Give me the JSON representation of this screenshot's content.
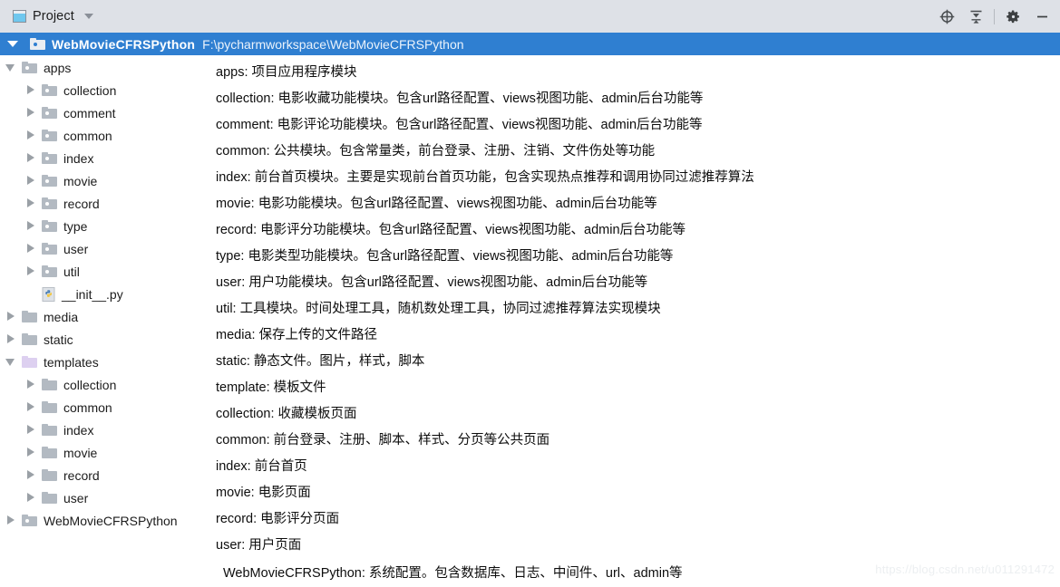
{
  "toolbar": {
    "tab_label": "Project",
    "project_icon": "project-panel-icon",
    "dropdown_icon": "chevron-down-icon",
    "actions": [
      {
        "name": "locate-target-icon",
        "glyph": "target"
      },
      {
        "name": "collapse-all-icon",
        "glyph": "collapse"
      },
      {
        "name": "settings-gear-icon",
        "glyph": "gear"
      },
      {
        "name": "hide-panel-icon",
        "glyph": "minus"
      }
    ]
  },
  "project_row": {
    "name": "WebMovieCFRSPython",
    "path": "F:\\pycharmworkspace\\WebMovieCFRSPython",
    "expanded": true
  },
  "tree": [
    {
      "label": "apps",
      "depth": 1,
      "state": "expanded",
      "icon": "folder-dot"
    },
    {
      "label": "collection",
      "depth": 2,
      "state": "collapsed",
      "icon": "folder-dot"
    },
    {
      "label": "comment",
      "depth": 2,
      "state": "collapsed",
      "icon": "folder-dot"
    },
    {
      "label": "common",
      "depth": 2,
      "state": "collapsed",
      "icon": "folder-dot"
    },
    {
      "label": "index",
      "depth": 2,
      "state": "collapsed",
      "icon": "folder-dot"
    },
    {
      "label": "movie",
      "depth": 2,
      "state": "collapsed",
      "icon": "folder-dot"
    },
    {
      "label": "record",
      "depth": 2,
      "state": "collapsed",
      "icon": "folder-dot"
    },
    {
      "label": "type",
      "depth": 2,
      "state": "collapsed",
      "icon": "folder-dot"
    },
    {
      "label": "user",
      "depth": 2,
      "state": "collapsed",
      "icon": "folder-dot"
    },
    {
      "label": "util",
      "depth": 2,
      "state": "collapsed",
      "icon": "folder-dot"
    },
    {
      "label": "__init__.py",
      "depth": 2,
      "state": "leaf",
      "icon": "python-file"
    },
    {
      "label": "media",
      "depth": 1,
      "state": "collapsed",
      "icon": "folder-plain"
    },
    {
      "label": "static",
      "depth": 1,
      "state": "collapsed",
      "icon": "folder-plain"
    },
    {
      "label": "templates",
      "depth": 1,
      "state": "expanded",
      "icon": "folder-purple"
    },
    {
      "label": "collection",
      "depth": 2,
      "state": "collapsed",
      "icon": "folder-plain"
    },
    {
      "label": "common",
      "depth": 2,
      "state": "collapsed",
      "icon": "folder-plain"
    },
    {
      "label": "index",
      "depth": 2,
      "state": "collapsed",
      "icon": "folder-plain"
    },
    {
      "label": "movie",
      "depth": 2,
      "state": "collapsed",
      "icon": "folder-plain"
    },
    {
      "label": "record",
      "depth": 2,
      "state": "collapsed",
      "icon": "folder-plain"
    },
    {
      "label": "user",
      "depth": 2,
      "state": "collapsed",
      "icon": "folder-plain"
    },
    {
      "label": "WebMovieCFRSPython",
      "depth": 1,
      "state": "collapsed",
      "icon": "folder-dot"
    }
  ],
  "descriptions": [
    {
      "text": "apps:  项目应用程序模块",
      "indent": false
    },
    {
      "text": "collection:  电影收藏功能模块。包含url路径配置、views视图功能、admin后台功能等",
      "indent": false
    },
    {
      "text": "comment:  电影评论功能模块。包含url路径配置、views视图功能、admin后台功能等",
      "indent": false
    },
    {
      "text": "common:  公共模块。包含常量类，前台登录、注册、注销、文件伤处等功能",
      "indent": false
    },
    {
      "text": "index:  前台首页模块。主要是实现前台首页功能，包含实现热点推荐和调用协同过滤推荐算法",
      "indent": false
    },
    {
      "text": "movie:  电影功能模块。包含url路径配置、views视图功能、admin后台功能等",
      "indent": false
    },
    {
      "text": "record:  电影评分功能模块。包含url路径配置、views视图功能、admin后台功能等",
      "indent": false
    },
    {
      "text": "type:  电影类型功能模块。包含url路径配置、views视图功能、admin后台功能等",
      "indent": false
    },
    {
      "text": "user:  用户功能模块。包含url路径配置、views视图功能、admin后台功能等",
      "indent": false
    },
    {
      "text": "util:  工具模块。时间处理工具，随机数处理工具，协同过滤推荐算法实现模块",
      "indent": false
    },
    {
      "text": "media:  保存上传的文件路径",
      "indent": false
    },
    {
      "text": "static:  静态文件。图片，样式，脚本",
      "indent": false
    },
    {
      "text": "template:  模板文件",
      "indent": false
    },
    {
      "text": "collection:  收藏模板页面",
      "indent": false
    },
    {
      "text": "common:  前台登录、注册、脚本、样式、分页等公共页面",
      "indent": false
    },
    {
      "text": "index:  前台首页",
      "indent": false
    },
    {
      "text": "movie:  电影页面",
      "indent": false
    },
    {
      "text": "record:  电影评分页面",
      "indent": false
    },
    {
      "text": "user:  用户页面",
      "indent": false
    },
    {
      "text": "WebMovieCFRSPython:  系统配置。包含数据库、日志、中间件、url、admin等",
      "indent": true
    }
  ],
  "watermark": "https://blog.csdn.net/u011291472",
  "colors": {
    "toolbar_bg": "#dee1e7",
    "selection_blue": "#2f7fd1",
    "folder_gray": "#b3bac2",
    "folder_purple": "#ddd0f0",
    "text": "#1c1c1c"
  }
}
